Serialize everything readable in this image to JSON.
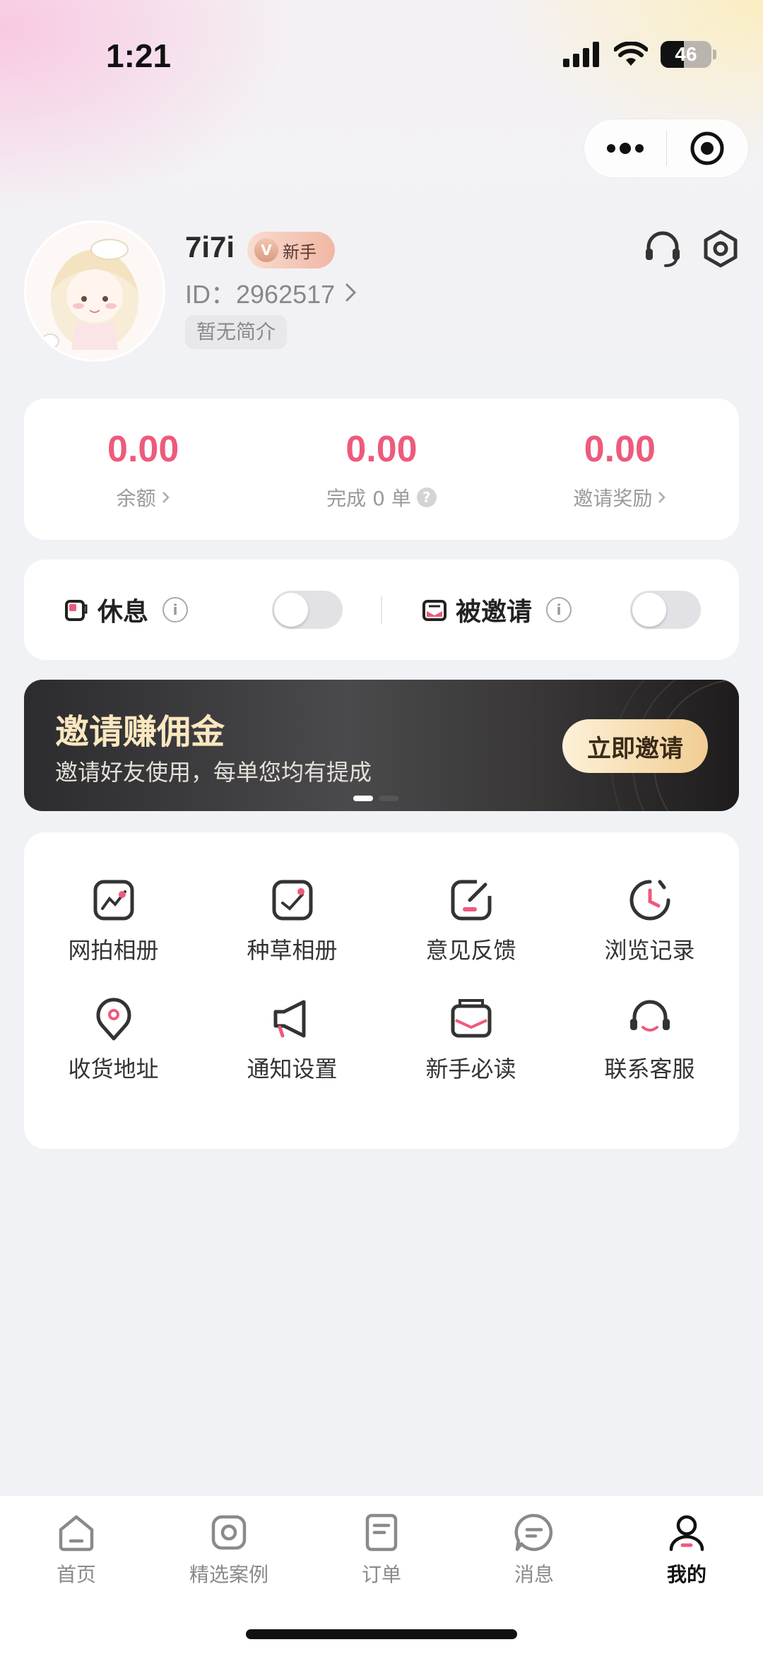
{
  "status_bar": {
    "time": "1:21",
    "battery_level": "46"
  },
  "profile": {
    "name": "7i7i",
    "level_badge": "新手",
    "id_label": "ID：",
    "id_value": "2962517",
    "bio": "暂无简介"
  },
  "stats": [
    {
      "value": "0.00",
      "label": "余额"
    },
    {
      "value": "0.00",
      "label": "完成 0 单"
    },
    {
      "value": "0.00",
      "label": "邀请奖励"
    }
  ],
  "toggles": [
    {
      "label": "休息",
      "on": false
    },
    {
      "label": "被邀请",
      "on": false
    }
  ],
  "banner": {
    "title": "邀请赚佣金",
    "subtitle": "邀请好友使用，每单您均有提成",
    "button_label": "立即邀请"
  },
  "menu": [
    {
      "label": "网拍相册",
      "icon": "album-chart-icon"
    },
    {
      "label": "种草相册",
      "icon": "album-check-icon"
    },
    {
      "label": "意见反馈",
      "icon": "feedback-icon"
    },
    {
      "label": "浏览记录",
      "icon": "history-clock-icon"
    },
    {
      "label": "收货地址",
      "icon": "location-pin-icon"
    },
    {
      "label": "通知设置",
      "icon": "megaphone-icon"
    },
    {
      "label": "新手必读",
      "icon": "mailbox-icon"
    },
    {
      "label": "联系客服",
      "icon": "headset-icon"
    }
  ],
  "tabs": [
    {
      "label": "首页",
      "icon": "home-icon",
      "active": false
    },
    {
      "label": "精选案例",
      "icon": "featured-cases-icon",
      "active": false
    },
    {
      "label": "订单",
      "icon": "orders-icon",
      "active": false
    },
    {
      "label": "消息",
      "icon": "message-icon",
      "active": false
    },
    {
      "label": "我的",
      "icon": "profile-icon",
      "active": true
    }
  ],
  "colors": {
    "accent_pink": "#ee5a7b",
    "banner_gold": "#f1cd93",
    "page_bg": "#f1f2f6"
  }
}
